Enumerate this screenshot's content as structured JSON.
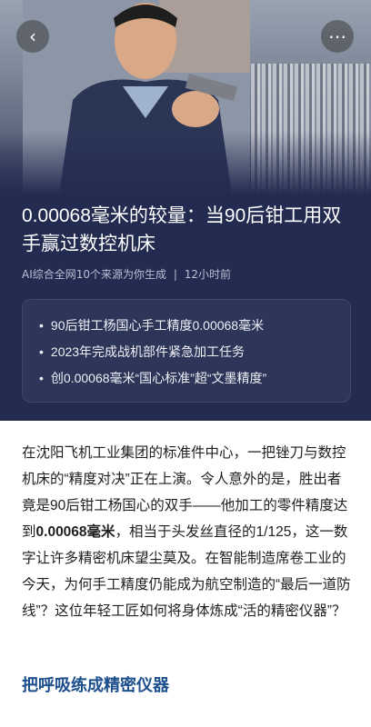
{
  "nav": {
    "back_icon": "chevron-left-icon",
    "more_icon": "more-dots-icon",
    "back_glyph": "‹",
    "more_glyph": "⋯"
  },
  "article": {
    "title": "0.00068毫米的较量：当90后钳工用双手赢过数控机床",
    "meta_source": "AI综合全网10个来源为你生成",
    "meta_sep": "|",
    "meta_time": "12小时前",
    "summary": [
      "90后钳工杨国心手工精度0.00068毫米",
      "2023年完成战机部件紧急加工任务",
      "创0.00068毫米“国心标准”超“文墨精度”"
    ],
    "body_part1": "在沈阳飞机工业集团的标准件中心，一把锉刀与数控机床的“精度对决”正在上演。令人意外的是，胜出者竟是90后钳工杨国心的双手——他加工的零件精度达到",
    "body_bold": "0.00068毫米",
    "body_part2": "，相当于头发丝直径的1/125，这一数字让许多精密机床望尘莫及。在智能制造席卷工业的今天，为何手工精度仍能成为航空制造的“最后一道防线”？这位年轻工匠如何将身体炼成“活的精密仪器”？",
    "section_heading": "把呼吸练成精密仪器"
  },
  "colors": {
    "header_bg": "#232b50",
    "section_heading": "#1e4f8d"
  }
}
